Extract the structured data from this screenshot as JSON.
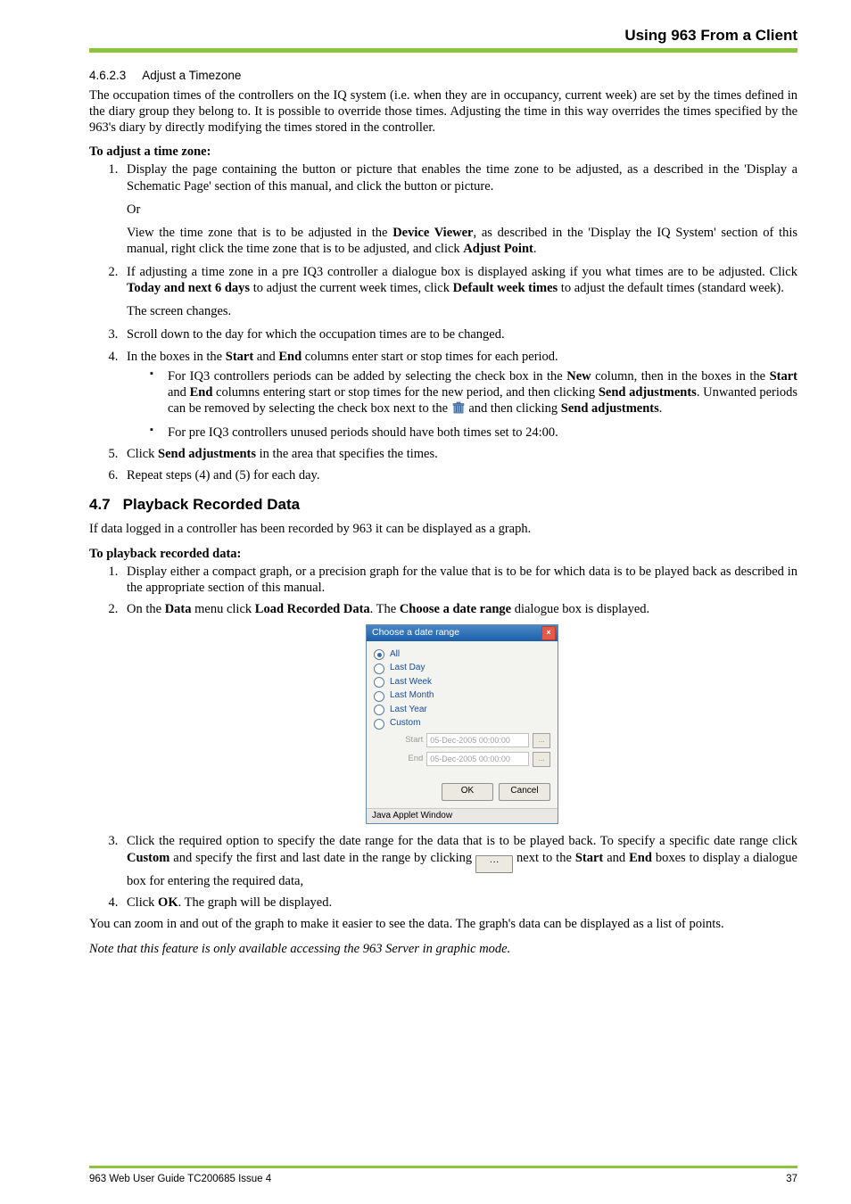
{
  "header": {
    "title": "Using 963 From a Client"
  },
  "sec4623": {
    "num": "4.6.2.3",
    "title": "Adjust a Timezone",
    "intro": "The occupation times of the controllers on the IQ system (i.e. when they are in occupancy, current week) are set by the times defined in the diary group they belong to. It is possible to override those times. Adjusting the time in this way overrides the times specified by the 963's diary by directly modifying the times stored in the controller.",
    "bold": "To adjust a time zone:",
    "step1a": "Display the page containing the button or picture that enables the time zone to be adjusted, as a described in the 'Display a Schematic Page' section of this manual, and click the button or picture.",
    "or": "Or",
    "step1b_pre": "View the time zone that is to be adjusted in the ",
    "step1b_bold1": "Device Viewer",
    "step1b_mid": ", as described in the 'Display the IQ System' section of this manual, right click the time zone that is to be adjusted, and click ",
    "step1b_bold2": "Adjust Point",
    "step1b_post": ".",
    "step2_pre": "If adjusting a time zone in a pre IQ3 controller a dialogue box is displayed asking if you what times are to be adjusted. Click ",
    "step2_b1": "Today and next 6 days",
    "step2_mid": " to adjust the current week times, click ",
    "step2_b2": "Default week times",
    "step2_post": " to adjust the default times (standard week).",
    "step2_after": "The screen changes.",
    "step3": "Scroll down to the day for which the occupation times are to be changed.",
    "step4_pre": "In the boxes in the ",
    "step4_b1": "Start",
    "step4_mid1": " and ",
    "step4_b2": "End",
    "step4_post": " columns enter start or stop times for each period.",
    "bullet1_pre": "For IQ3 controllers periods can be added by selecting the check box in the ",
    "bullet1_b1": "New",
    "bullet1_m1": " column, then in the boxes in the ",
    "bullet1_b2": "Start",
    "bullet1_m2": " and ",
    "bullet1_b3": "End",
    "bullet1_m3": " columns entering start or stop times for the new period, and then clicking ",
    "bullet1_b4": "Send adjustments",
    "bullet1_m4": ". Unwanted periods can be removed by selecting the check box next to the ",
    "bullet1_m5": " and then clicking ",
    "bullet1_b5": "Send adjustments",
    "bullet1_end": ".",
    "bullet2": "For pre IQ3 controllers unused periods should have both times set to 24:00.",
    "step5_pre": "Click ",
    "step5_b": "Send adjustments",
    "step5_post": " in the area that specifies the times.",
    "step6": "Repeat steps (4) and (5) for each day."
  },
  "sec47": {
    "num": "4.7",
    "title": "Playback Recorded Data",
    "intro": "If data logged in a controller has been recorded by 963 it can be displayed as a graph.",
    "bold": "To playback recorded data:",
    "step1": "Display either a compact graph, or a precision graph for the value that is to be for which data is to be played back as described in the appropriate section of this manual.",
    "step2_pre": "On the ",
    "step2_b1": "Data",
    "step2_m1": " menu click ",
    "step2_b2": "Load Recorded Data",
    "step2_m2": ". The ",
    "step2_b3": "Choose a date range",
    "step2_post": " dialogue box is displayed.",
    "step3_pre": "Click the required option to specify the date range for the data that is to be played back. To specify a specific date range click ",
    "step3_b1": "Custom",
    "step3_m1": " and specify the first and last date in the range by clicking ",
    "step3_m2": " next to the ",
    "step3_b2": "Start",
    "step3_m3": " and ",
    "step3_b3": "End",
    "step3_post": " boxes to display a dialogue box for entering the required data,",
    "step4_pre": "Click ",
    "step4_b": "OK",
    "step4_post": ". The graph will be displayed.",
    "after": "You can zoom in and out of the graph to make it easier to see the data. The graph's data can be displayed as a list of points.",
    "note": "Note that this feature is only available accessing the 963 Server in graphic mode."
  },
  "dialog": {
    "title": "Choose a date range",
    "opts": {
      "all": "All",
      "day": "Last Day",
      "week": "Last Week",
      "month": "Last Month",
      "year": "Last Year",
      "custom": "Custom"
    },
    "start_label": "Start",
    "end_label": "End",
    "start_val": "05-Dec-2005 00:00:00",
    "end_val": "05-Dec-2005 00:00:00",
    "dots": "...",
    "ok": "OK",
    "cancel": "Cancel",
    "status": "Java Applet Window"
  },
  "footer": {
    "left": "963 Web User Guide TC200685 Issue 4",
    "right": "37"
  }
}
